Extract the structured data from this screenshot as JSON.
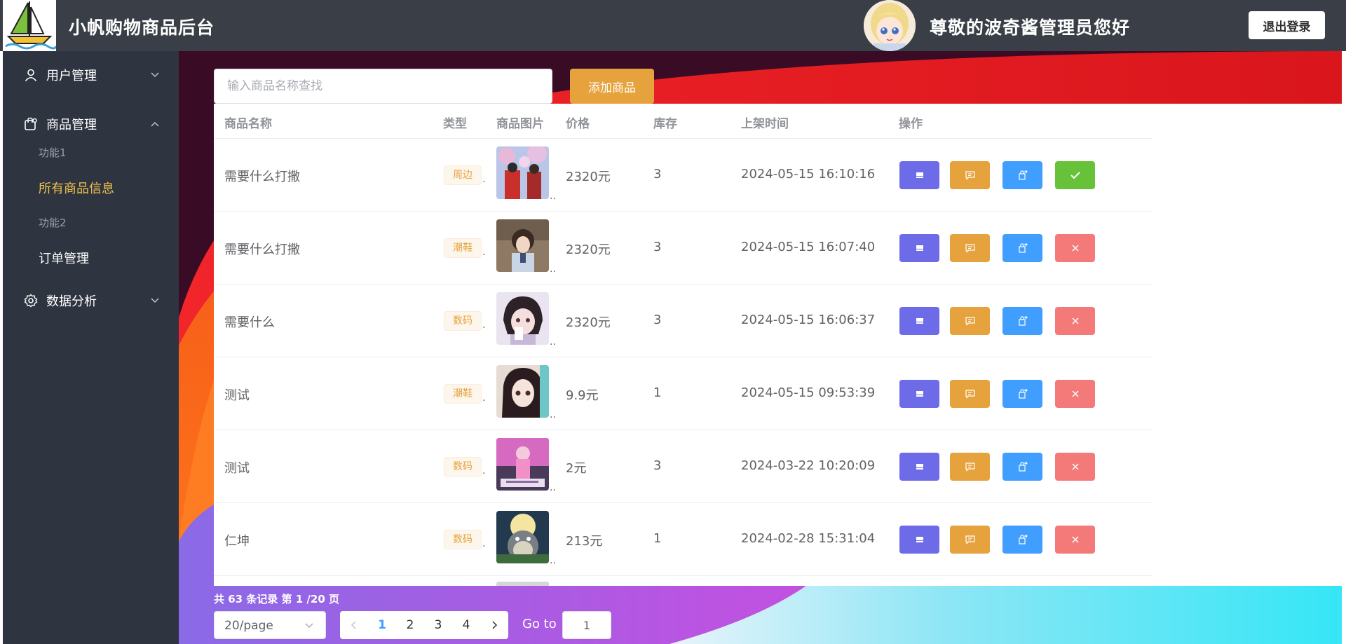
{
  "header": {
    "title": "小帆购物商品后台",
    "greeting": "尊敬的波奇酱管理员您好",
    "logout_label": "退出登录"
  },
  "sidebar": {
    "user_mgmt": "用户管理",
    "product_mgmt": "商品管理",
    "sub_items": [
      "功能1",
      "所有商品信息",
      "功能2",
      "订单管理"
    ],
    "data_analysis": "数据分析"
  },
  "search": {
    "placeholder": "输入商品名称查找",
    "add_label": "添加商品"
  },
  "table": {
    "columns": [
      "商品名称",
      "类型",
      "商品图片",
      "价格",
      "库存",
      "上架时间",
      "操作"
    ],
    "rows": [
      {
        "name": "需要什么打撒",
        "type": "周边",
        "price": "2320元",
        "stock": "3",
        "time": "2024-05-15 16:10:16",
        "status": "on"
      },
      {
        "name": "需要什么打撒",
        "type": "潮鞋",
        "price": "2320元",
        "stock": "3",
        "time": "2024-05-15 16:07:40",
        "status": "off"
      },
      {
        "name": "需要什么",
        "type": "数码",
        "price": "2320元",
        "stock": "3",
        "time": "2024-05-15 16:06:37",
        "status": "off"
      },
      {
        "name": "测试",
        "type": "潮鞋",
        "price": "9.9元",
        "stock": "1",
        "time": "2024-05-15 09:53:39",
        "status": "off"
      },
      {
        "name": "测试",
        "type": "数码",
        "price": "2元",
        "stock": "3",
        "time": "2024-03-22 10:20:09",
        "status": "off"
      },
      {
        "name": "仁坤",
        "type": "数码",
        "price": "213元",
        "stock": "1",
        "time": "2024-02-28 15:31:04",
        "status": "off"
      }
    ]
  },
  "pagination": {
    "summary": "共 63 条记录 第 1 /20 页",
    "page_size": "20/page",
    "pages": [
      "1",
      "2",
      "3",
      "4"
    ],
    "current_page": "1",
    "goto_label": "Go to",
    "goto_value": "1"
  },
  "colors": {
    "header_bg": "#3a3f47",
    "sidebar_bg": "#2e3440",
    "active_menu": "#f1c24c",
    "add_button": "#e6a23c",
    "op_indigo": "#6d6be7",
    "op_orange": "#e6a23c",
    "op_blue": "#409eff",
    "op_green": "#67c23a",
    "op_red": "#f47a7a"
  }
}
